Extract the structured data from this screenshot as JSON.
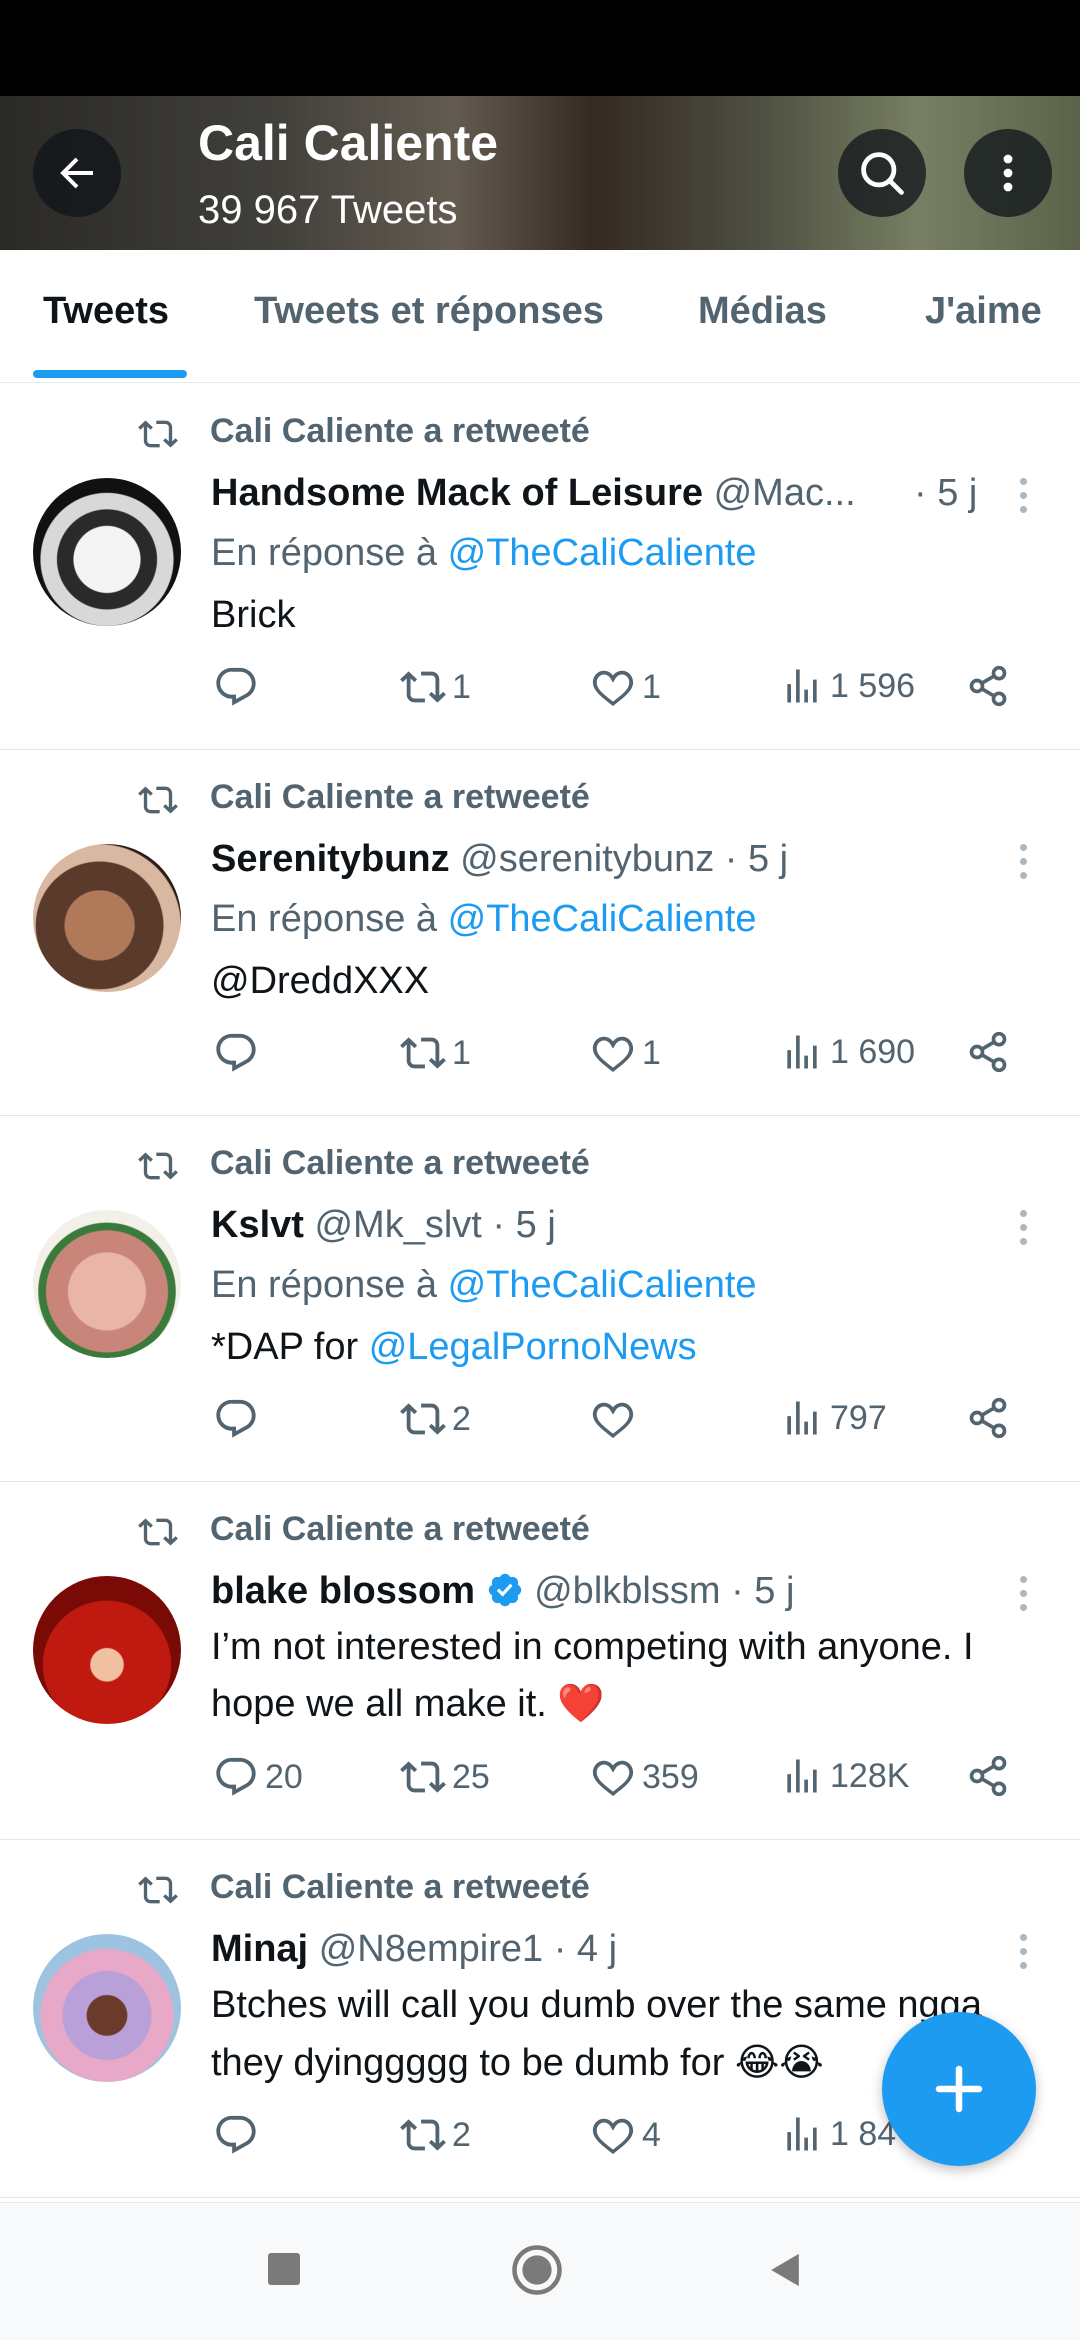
{
  "header": {
    "title": "Cali Caliente",
    "subtitle": "39 967 Tweets"
  },
  "tabs": [
    {
      "label": "Tweets",
      "active": true
    },
    {
      "label": "Tweets et réponses",
      "active": false
    },
    {
      "label": "Médias",
      "active": false
    },
    {
      "label": "J'aime",
      "active": false
    }
  ],
  "tweets": [
    {
      "retweet_label": "Cali Caliente a retweeté",
      "name": "Handsome Mack of Leisure",
      "handle": "@Mac...",
      "time": "· 5 j",
      "reply_prefix": "En réponse à",
      "reply_to": "@TheCaliCaliente",
      "body": "Brick",
      "replies": "",
      "retweets": "1",
      "likes": "1",
      "views": "1 596"
    },
    {
      "retweet_label": "Cali Caliente a retweeté",
      "name": "Serenitybunz",
      "handle": "@serenitybunz",
      "time": "· 5 j",
      "reply_prefix": "En réponse à",
      "reply_to": "@TheCaliCaliente",
      "body_link": "@DreddXXX",
      "replies": "",
      "retweets": "1",
      "likes": "1",
      "views": "1 690"
    },
    {
      "retweet_label": "Cali Caliente a retweeté",
      "name": "Kslvt",
      "handle": "@Mk_slvt",
      "time": "· 5 j",
      "reply_prefix": "En réponse à",
      "reply_to": "@TheCaliCaliente",
      "body": "*DAP for",
      "body_link": "@LegalPornoNews",
      "replies": "",
      "retweets": "2",
      "likes": "",
      "views": "797"
    },
    {
      "retweet_label": "Cali Caliente a retweeté",
      "name": "blake blossom",
      "handle": "@blkblssm",
      "time": "· 5 j",
      "verified": true,
      "body_line1": "I’m not interested in competing with anyone. I",
      "body_line2": "hope we all make it. ❤️",
      "replies": "20",
      "retweets": "25",
      "likes": "359",
      "views": "128K"
    },
    {
      "retweet_label": "Cali Caliente a retweeté",
      "name": "Minaj",
      "handle": "@N8empire1",
      "time": "· 4 j",
      "body_line1": "Btches will call you dumb over the same ngga",
      "body_line2": "they dyinggggg to be dumb for 😂😭",
      "replies": "",
      "retweets": "2",
      "likes": "4",
      "views": "1 84"
    }
  ],
  "colors": {
    "accent": "#1d9bf0",
    "text": "#0f1419",
    "secondary": "#536471",
    "heart": "#e0245e"
  },
  "icons": [
    "back-arrow-icon",
    "search-icon",
    "more-vertical-icon",
    "retweet-icon",
    "reply-icon",
    "like-icon",
    "views-icon",
    "share-icon",
    "verified-icon",
    "compose-plus-icon",
    "nav-recents-icon",
    "nav-home-icon",
    "nav-back-icon"
  ]
}
